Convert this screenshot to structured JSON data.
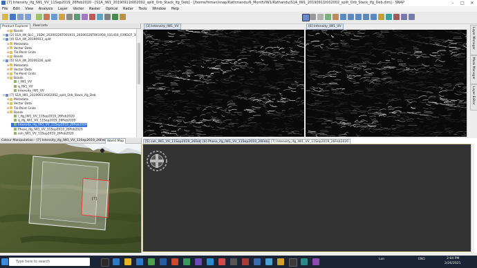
{
  "window": {
    "title": "[7] Intensity_ifg_IW1_VV_11Sep2019_26Feb2020 - [S1A_IW1_20190911t002002_split_Orb_Stack_ifg_Deb] - [/home/himan/snap/Kathmandu/6_Month/IW1/Kathandu/S1A_IW1_20190911t002002_split_Orb_Stack_ifg_Deb.dim] - SNAP"
  },
  "menu": [
    "File",
    "Edit",
    "View",
    "Analysis",
    "Layer",
    "Vector",
    "Raster",
    "Optical",
    "Radar",
    "Tools",
    "Window",
    "Help"
  ],
  "product_explorer": {
    "tabs": [
      "Product Explorer",
      "Pixel Info"
    ],
    "rows": [
      {
        "indent": 1,
        "kind": "folder",
        "label": "Bands"
      },
      {
        "indent": 0,
        "kind": "prod",
        "label": "[2] S1A_IW_SLC__1SDV_20200226T001931_20200226T001958_031416_039DCF_35C2"
      },
      {
        "indent": 0,
        "kind": "prod",
        "label": "[4] S1A_IW_20190911_split"
      },
      {
        "indent": 1,
        "kind": "folder",
        "label": "Metadata"
      },
      {
        "indent": 1,
        "kind": "folder",
        "label": "Vector Data"
      },
      {
        "indent": 1,
        "kind": "folder",
        "label": "Tie-Point Grids"
      },
      {
        "indent": 1,
        "kind": "folder",
        "label": "Bands"
      },
      {
        "indent": 0,
        "kind": "prod",
        "label": "[5] S1A_IW_20200226_split"
      },
      {
        "indent": 1,
        "kind": "folder",
        "label": "Metadata"
      },
      {
        "indent": 1,
        "kind": "folder",
        "label": "Vector Data"
      },
      {
        "indent": 1,
        "kind": "folder",
        "label": "Tie-Point Grids"
      },
      {
        "indent": 1,
        "kind": "folder",
        "label": "Bands"
      },
      {
        "indent": 2,
        "kind": "band",
        "label": "i_IW1_VV"
      },
      {
        "indent": 2,
        "kind": "band",
        "label": "q_IW1_VV"
      },
      {
        "indent": 2,
        "kind": "band",
        "label": "Intensity_IW1_VV"
      },
      {
        "indent": 0,
        "kind": "prod",
        "label": "[7] S1A_IW1_20190911t002002_split_Orb_Stack_ifg_Deb"
      },
      {
        "indent": 1,
        "kind": "folder",
        "label": "Metadata"
      },
      {
        "indent": 1,
        "kind": "folder",
        "label": "Vector Data"
      },
      {
        "indent": 1,
        "kind": "folder",
        "label": "Tie-Point Grids"
      },
      {
        "indent": 1,
        "kind": "folder",
        "label": "Bands"
      },
      {
        "indent": 2,
        "kind": "band",
        "label": "i_ifg_IW1_VV_11Sep2019_26Feb2020"
      },
      {
        "indent": 2,
        "kind": "band",
        "label": "q_ifg_IW1_VV_11Sep2019_26Feb2020"
      },
      {
        "indent": 2,
        "kind": "band",
        "label": "Intensity_ifg_IW1_VV_11Sep2019_26Feb2020",
        "selected": true
      },
      {
        "indent": 2,
        "kind": "band",
        "label": "Phase_ifg_IW1_VV_11Sep2019_26Feb2020"
      },
      {
        "indent": 2,
        "kind": "band",
        "label": "coh_IW1_VV_11Sep2019_26Feb2020"
      }
    ]
  },
  "views": {
    "top_left_tab": "[3] Intensity_IW1_VV",
    "top_right_tab": "[6] Intensity_IW1_VV",
    "bottom_tabs": [
      "[5] coh_IW1_VV_11Sep2019_26Feb2020",
      "[6] Phase_ifg_IW1_VV_11Sep2019_26Feb2020",
      "[7] Intensity_ifg_IW1_VV_11Sep2019_26Feb2020"
    ]
  },
  "bottom_left": {
    "tabs": [
      "Colour Manipulation - [7] Intensity_ifg_IW1_VV_11Sep2019_26Feb2020",
      "World Map"
    ],
    "footprint_label": "[7]"
  },
  "right_side_tabs": [
    "Layer Manager",
    "Mask Manager",
    "Layer Editor"
  ],
  "taskbar": {
    "search_placeholder": "Type here to search",
    "lang": "ENG",
    "time": "2:04 PM",
    "date": "2/26/2021",
    "weather": "Lon"
  }
}
